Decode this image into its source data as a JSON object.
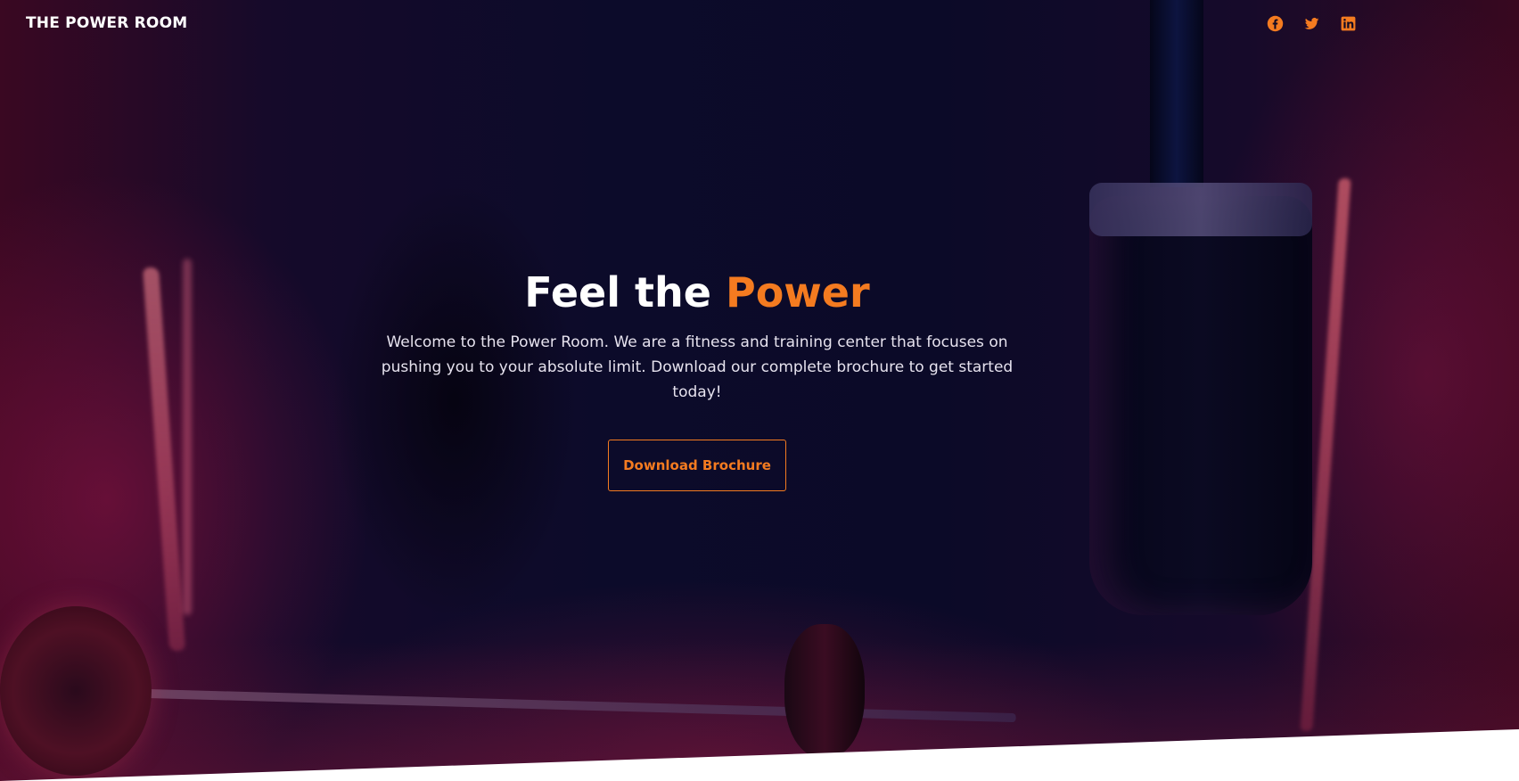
{
  "header": {
    "brand": "THE POWER ROOM",
    "social": [
      {
        "name": "facebook-icon"
      },
      {
        "name": "twitter-icon"
      },
      {
        "name": "linkedin-icon"
      }
    ]
  },
  "hero": {
    "title_plain": "Feel the ",
    "title_accent": "Power",
    "description": "Welcome to the Power Room. We are a fitness and training center that focuses on pushing you to your absolute limit. Download our complete brochure to get started today!",
    "cta_label": "Download Brochure"
  },
  "colors": {
    "accent": "#f47b20",
    "text": "#ffffff",
    "background_dark": "#0c0b2a",
    "background_magenta": "#3a0822"
  }
}
